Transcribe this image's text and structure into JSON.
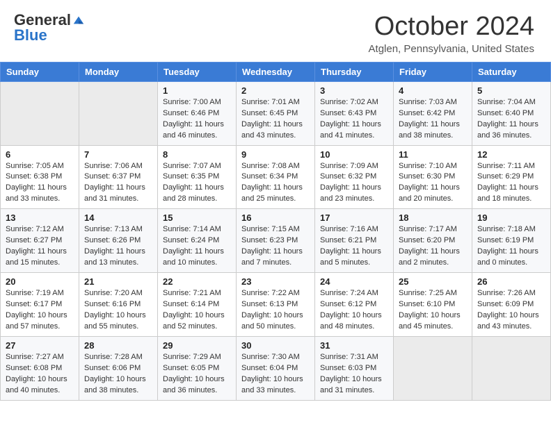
{
  "header": {
    "logo_general": "General",
    "logo_blue": "Blue",
    "month_title": "October 2024",
    "location": "Atglen, Pennsylvania, United States"
  },
  "weekdays": [
    "Sunday",
    "Monday",
    "Tuesday",
    "Wednesday",
    "Thursday",
    "Friday",
    "Saturday"
  ],
  "weeks": [
    [
      {
        "day": "",
        "sunrise": "",
        "sunset": "",
        "daylight": "",
        "empty": true
      },
      {
        "day": "",
        "sunrise": "",
        "sunset": "",
        "daylight": "",
        "empty": true
      },
      {
        "day": "1",
        "sunrise": "Sunrise: 7:00 AM",
        "sunset": "Sunset: 6:46 PM",
        "daylight": "Daylight: 11 hours and 46 minutes."
      },
      {
        "day": "2",
        "sunrise": "Sunrise: 7:01 AM",
        "sunset": "Sunset: 6:45 PM",
        "daylight": "Daylight: 11 hours and 43 minutes."
      },
      {
        "day": "3",
        "sunrise": "Sunrise: 7:02 AM",
        "sunset": "Sunset: 6:43 PM",
        "daylight": "Daylight: 11 hours and 41 minutes."
      },
      {
        "day": "4",
        "sunrise": "Sunrise: 7:03 AM",
        "sunset": "Sunset: 6:42 PM",
        "daylight": "Daylight: 11 hours and 38 minutes."
      },
      {
        "day": "5",
        "sunrise": "Sunrise: 7:04 AM",
        "sunset": "Sunset: 6:40 PM",
        "daylight": "Daylight: 11 hours and 36 minutes."
      }
    ],
    [
      {
        "day": "6",
        "sunrise": "Sunrise: 7:05 AM",
        "sunset": "Sunset: 6:38 PM",
        "daylight": "Daylight: 11 hours and 33 minutes."
      },
      {
        "day": "7",
        "sunrise": "Sunrise: 7:06 AM",
        "sunset": "Sunset: 6:37 PM",
        "daylight": "Daylight: 11 hours and 31 minutes."
      },
      {
        "day": "8",
        "sunrise": "Sunrise: 7:07 AM",
        "sunset": "Sunset: 6:35 PM",
        "daylight": "Daylight: 11 hours and 28 minutes."
      },
      {
        "day": "9",
        "sunrise": "Sunrise: 7:08 AM",
        "sunset": "Sunset: 6:34 PM",
        "daylight": "Daylight: 11 hours and 25 minutes."
      },
      {
        "day": "10",
        "sunrise": "Sunrise: 7:09 AM",
        "sunset": "Sunset: 6:32 PM",
        "daylight": "Daylight: 11 hours and 23 minutes."
      },
      {
        "day": "11",
        "sunrise": "Sunrise: 7:10 AM",
        "sunset": "Sunset: 6:30 PM",
        "daylight": "Daylight: 11 hours and 20 minutes."
      },
      {
        "day": "12",
        "sunrise": "Sunrise: 7:11 AM",
        "sunset": "Sunset: 6:29 PM",
        "daylight": "Daylight: 11 hours and 18 minutes."
      }
    ],
    [
      {
        "day": "13",
        "sunrise": "Sunrise: 7:12 AM",
        "sunset": "Sunset: 6:27 PM",
        "daylight": "Daylight: 11 hours and 15 minutes."
      },
      {
        "day": "14",
        "sunrise": "Sunrise: 7:13 AM",
        "sunset": "Sunset: 6:26 PM",
        "daylight": "Daylight: 11 hours and 13 minutes."
      },
      {
        "day": "15",
        "sunrise": "Sunrise: 7:14 AM",
        "sunset": "Sunset: 6:24 PM",
        "daylight": "Daylight: 11 hours and 10 minutes."
      },
      {
        "day": "16",
        "sunrise": "Sunrise: 7:15 AM",
        "sunset": "Sunset: 6:23 PM",
        "daylight": "Daylight: 11 hours and 7 minutes."
      },
      {
        "day": "17",
        "sunrise": "Sunrise: 7:16 AM",
        "sunset": "Sunset: 6:21 PM",
        "daylight": "Daylight: 11 hours and 5 minutes."
      },
      {
        "day": "18",
        "sunrise": "Sunrise: 7:17 AM",
        "sunset": "Sunset: 6:20 PM",
        "daylight": "Daylight: 11 hours and 2 minutes."
      },
      {
        "day": "19",
        "sunrise": "Sunrise: 7:18 AM",
        "sunset": "Sunset: 6:19 PM",
        "daylight": "Daylight: 11 hours and 0 minutes."
      }
    ],
    [
      {
        "day": "20",
        "sunrise": "Sunrise: 7:19 AM",
        "sunset": "Sunset: 6:17 PM",
        "daylight": "Daylight: 10 hours and 57 minutes."
      },
      {
        "day": "21",
        "sunrise": "Sunrise: 7:20 AM",
        "sunset": "Sunset: 6:16 PM",
        "daylight": "Daylight: 10 hours and 55 minutes."
      },
      {
        "day": "22",
        "sunrise": "Sunrise: 7:21 AM",
        "sunset": "Sunset: 6:14 PM",
        "daylight": "Daylight: 10 hours and 52 minutes."
      },
      {
        "day": "23",
        "sunrise": "Sunrise: 7:22 AM",
        "sunset": "Sunset: 6:13 PM",
        "daylight": "Daylight: 10 hours and 50 minutes."
      },
      {
        "day": "24",
        "sunrise": "Sunrise: 7:24 AM",
        "sunset": "Sunset: 6:12 PM",
        "daylight": "Daylight: 10 hours and 48 minutes."
      },
      {
        "day": "25",
        "sunrise": "Sunrise: 7:25 AM",
        "sunset": "Sunset: 6:10 PM",
        "daylight": "Daylight: 10 hours and 45 minutes."
      },
      {
        "day": "26",
        "sunrise": "Sunrise: 7:26 AM",
        "sunset": "Sunset: 6:09 PM",
        "daylight": "Daylight: 10 hours and 43 minutes."
      }
    ],
    [
      {
        "day": "27",
        "sunrise": "Sunrise: 7:27 AM",
        "sunset": "Sunset: 6:08 PM",
        "daylight": "Daylight: 10 hours and 40 minutes."
      },
      {
        "day": "28",
        "sunrise": "Sunrise: 7:28 AM",
        "sunset": "Sunset: 6:06 PM",
        "daylight": "Daylight: 10 hours and 38 minutes."
      },
      {
        "day": "29",
        "sunrise": "Sunrise: 7:29 AM",
        "sunset": "Sunset: 6:05 PM",
        "daylight": "Daylight: 10 hours and 36 minutes."
      },
      {
        "day": "30",
        "sunrise": "Sunrise: 7:30 AM",
        "sunset": "Sunset: 6:04 PM",
        "daylight": "Daylight: 10 hours and 33 minutes."
      },
      {
        "day": "31",
        "sunrise": "Sunrise: 7:31 AM",
        "sunset": "Sunset: 6:03 PM",
        "daylight": "Daylight: 10 hours and 31 minutes."
      },
      {
        "day": "",
        "sunrise": "",
        "sunset": "",
        "daylight": "",
        "empty": true
      },
      {
        "day": "",
        "sunrise": "",
        "sunset": "",
        "daylight": "",
        "empty": true
      }
    ]
  ]
}
